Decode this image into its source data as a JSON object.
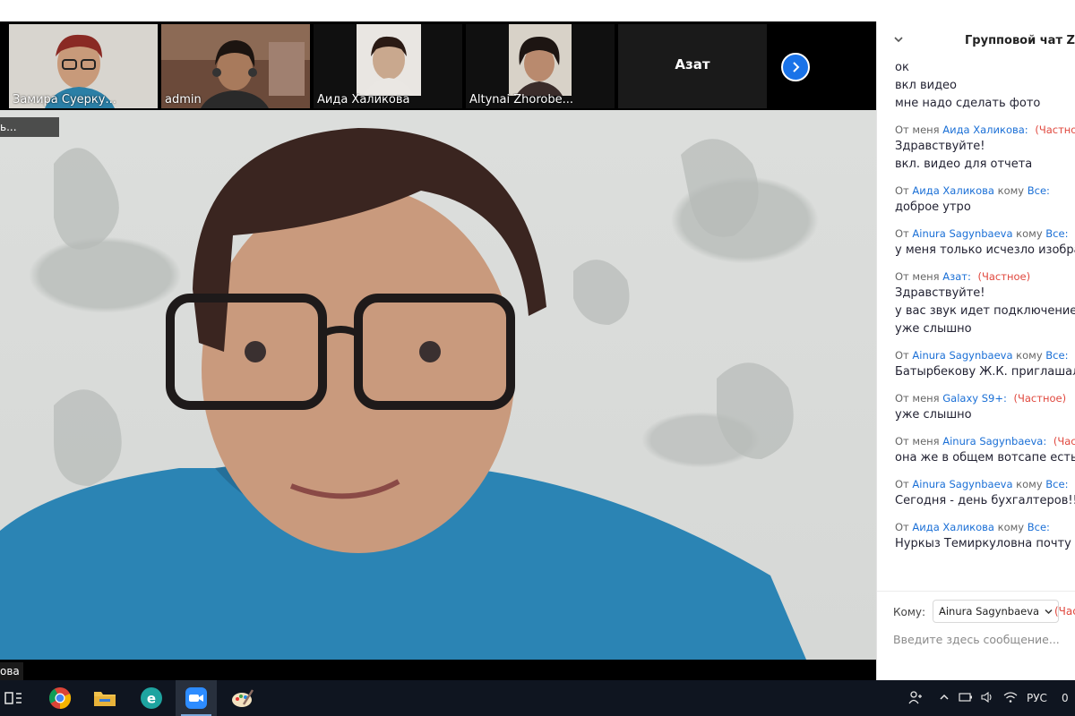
{
  "gallery": {
    "participants": [
      {
        "name": "Замира Суерку..."
      },
      {
        "name": "admin"
      },
      {
        "name": "Аида Халикова"
      },
      {
        "name": "Altynai Zhorobe..."
      },
      {
        "name": "Азат"
      }
    ]
  },
  "main_video": {
    "top_tag": "ь...",
    "bottom_tag": "ова"
  },
  "chat": {
    "title": "Групповой чат Zoo",
    "messages": [
      {
        "lines": [
          "ок",
          "вкл видео",
          "мне надо сделать фото"
        ]
      },
      {
        "from": "От меня",
        "who": "Аида Халикова:",
        "tag": "(Частное)",
        "lines": [
          "Здравствуйте!",
          "вкл. видео для отчета"
        ]
      },
      {
        "from": "От",
        "who": "Аида Халикова",
        "to_word": "кому",
        "to": "Все:",
        "lines": [
          "доброе утро"
        ]
      },
      {
        "from": "От",
        "who": "Ainura Sagynbaeva",
        "to_word": "кому",
        "to": "Все:",
        "lines": [
          "у меня только исчезло изобра"
        ]
      },
      {
        "from": "От меня",
        "who": "Азат:",
        "tag": "(Частное)",
        "lines": [
          "Здравствуйте!",
          "у вас звук идет подключение",
          "уже слышно"
        ]
      },
      {
        "from": "От",
        "who": "Ainura Sagynbaeva",
        "to_word": "кому",
        "to": "Все:",
        "lines": [
          "Батырбекову Ж.К. приглашали"
        ]
      },
      {
        "from": "От меня",
        "who": "Galaxy S9+:",
        "tag": "(Частное)",
        "lines": [
          "уже слышно"
        ]
      },
      {
        "from": "От меня",
        "who": "Ainura Sagynbaeva:",
        "tag": "(Частн",
        "lines": [
          "она же в общем вотсапе есть"
        ]
      },
      {
        "from": "От",
        "who": "Ainura Sagynbaeva",
        "to_word": "кому",
        "to": "Все:",
        "lines": [
          "Сегодня - день бухгалтеров!!!"
        ]
      },
      {
        "from": "От",
        "who": "Аида Халикова",
        "to_word": "кому",
        "to": "Все:",
        "lines": [
          "Нуркыз Темиркуловна почту н"
        ]
      }
    ],
    "to_label": "Кому:",
    "to_value": "Ainura Sagynbaeva",
    "to_private": "(Час",
    "input_placeholder": "Введите здесь сообщение..."
  },
  "taskbar": {
    "apps": [
      "task-view-icon",
      "chrome-icon",
      "file-explorer-icon",
      "eset-icon",
      "zoom-icon",
      "paint-icon"
    ],
    "tray": {
      "language": "РУС",
      "clock": "0"
    }
  },
  "colors": {
    "accent_blue": "#1a73e8",
    "private_red": "#e0483e",
    "name_blue": "#1a6fd6",
    "active_border": "#9acd32",
    "taskbar": "#0f1520"
  }
}
